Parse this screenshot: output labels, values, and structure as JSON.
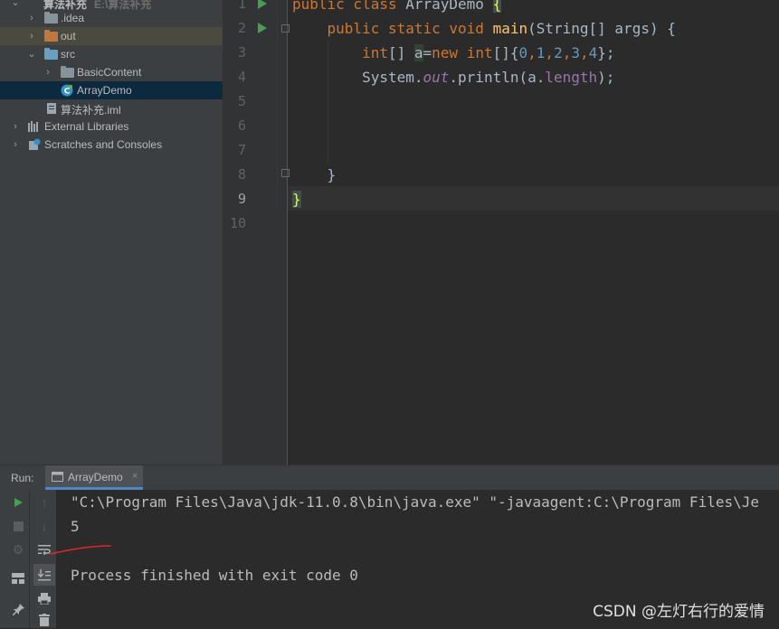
{
  "project_tree": {
    "root": {
      "label": "算法补充",
      "path": "E:\\算法补充"
    },
    "items": [
      {
        "label": ".idea",
        "type": "folder",
        "color": "#87939a"
      },
      {
        "label": "out",
        "type": "folder",
        "color": "#c07842"
      },
      {
        "label": "src",
        "type": "folder",
        "color": "#6a9fc2"
      },
      {
        "label": "BasicContent",
        "type": "package"
      },
      {
        "label": "ArrayDemo",
        "type": "class"
      },
      {
        "label": "算法补充.iml",
        "type": "file"
      },
      {
        "label": "External Libraries",
        "type": "library"
      },
      {
        "label": "Scratches and Consoles",
        "type": "scratch"
      }
    ]
  },
  "editor": {
    "line_numbers": [
      "1",
      "2",
      "3",
      "4",
      "5",
      "6",
      "7",
      "8",
      "9",
      "10"
    ],
    "current_line": "9",
    "code": {
      "l1": {
        "kw": "public class ",
        "name": "ArrayDemo ",
        "brace": "{"
      },
      "l2": {
        "kw": "public static void ",
        "fn": "main",
        "rest": "(String[] args) {"
      },
      "l3": {
        "kw1": "int",
        "t1": "[] ",
        "var": "a",
        "t2": "=",
        "kw2": "new ",
        "kw3": "int",
        "t3": "[]{",
        "n0": "0",
        "n1": "1",
        "n2": "2",
        "n3": "3",
        "n4": "4",
        "t4": "};",
        "comma": ","
      },
      "l4": {
        "t1": "System.",
        "out": "out",
        "t2": ".println(a.",
        "fld": "length",
        "t3": ");"
      },
      "l8": "}",
      "l9": "}"
    }
  },
  "run": {
    "label": "Run:",
    "tab": "ArrayDemo",
    "output": [
      "\"C:\\Program Files\\Java\\jdk-11.0.8\\bin\\java.exe\" \"-javaagent:C:\\Program Files\\Je",
      "5",
      "",
      "Process finished with exit code 0"
    ]
  },
  "watermark": "CSDN @左灯右行的爱情",
  "colors": {
    "accent_run": "#499c54",
    "selection": "#0d293e",
    "keyword": "#cc7832",
    "function": "#ffc66d",
    "number": "#6897bb"
  }
}
